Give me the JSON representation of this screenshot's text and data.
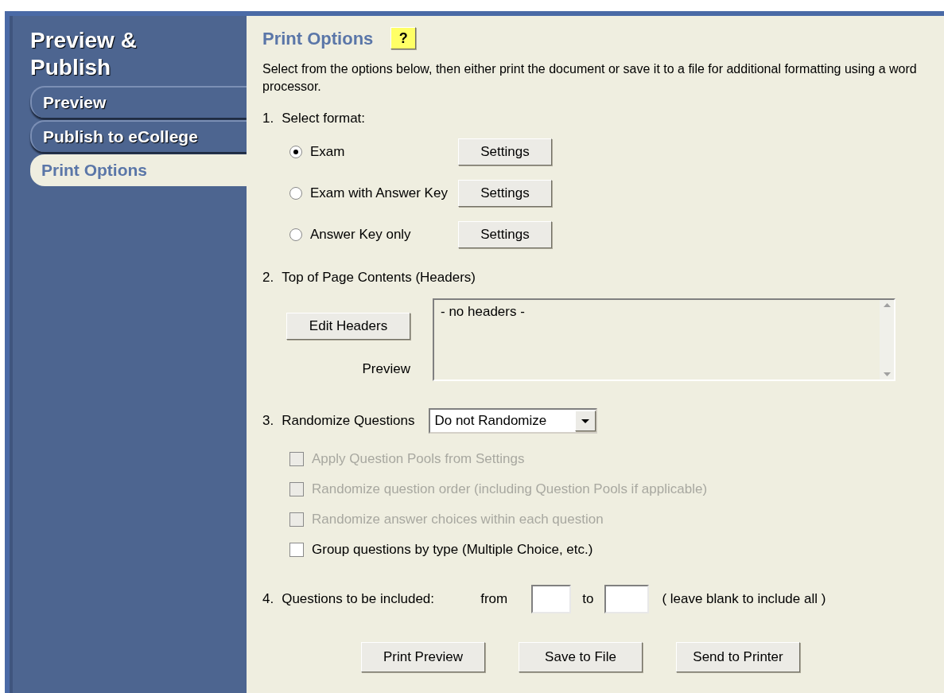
{
  "sidebar": {
    "title": "Preview & Publish",
    "items": [
      {
        "label": "Preview",
        "selected": false
      },
      {
        "label": "Publish to eCollege",
        "selected": false
      },
      {
        "label": "Print Options",
        "selected": true
      }
    ]
  },
  "panel": {
    "title": "Print Options",
    "help_button": "?",
    "description": "Select from the options below, then either print the document or save it to a file for additional formatting using a word processor.",
    "format": {
      "number": "1.",
      "label": "Select format:",
      "options": [
        {
          "label": "Exam",
          "selected": true,
          "button": "Settings"
        },
        {
          "label": "Exam with Answer Key",
          "selected": false,
          "button": "Settings"
        },
        {
          "label": "Answer Key only",
          "selected": false,
          "button": "Settings"
        }
      ]
    },
    "headers": {
      "number": "2.",
      "label": "Top of Page Contents (Headers)",
      "edit_button": "Edit Headers",
      "preview_label": "Preview",
      "preview_text": "- no headers -"
    },
    "randomize": {
      "number": "3.",
      "label": "Randomize Questions",
      "value": "Do not Randomize",
      "options": [
        {
          "label": "Apply Question Pools from Settings",
          "checked": false,
          "disabled": true
        },
        {
          "label": "Randomize question order (including Question Pools if applicable)",
          "checked": false,
          "disabled": true
        },
        {
          "label": "Randomize answer choices within each question",
          "checked": false,
          "disabled": true
        },
        {
          "label": "Group questions by type (Multiple Choice, etc.)",
          "checked": false,
          "disabled": false
        }
      ]
    },
    "range": {
      "number": "4.",
      "label": "Questions to be included:",
      "from_label": "from",
      "to_label": "to",
      "hint": "( leave blank to include all )"
    },
    "buttons": [
      "Print Preview",
      "Save to File",
      "Send to Printer"
    ]
  }
}
